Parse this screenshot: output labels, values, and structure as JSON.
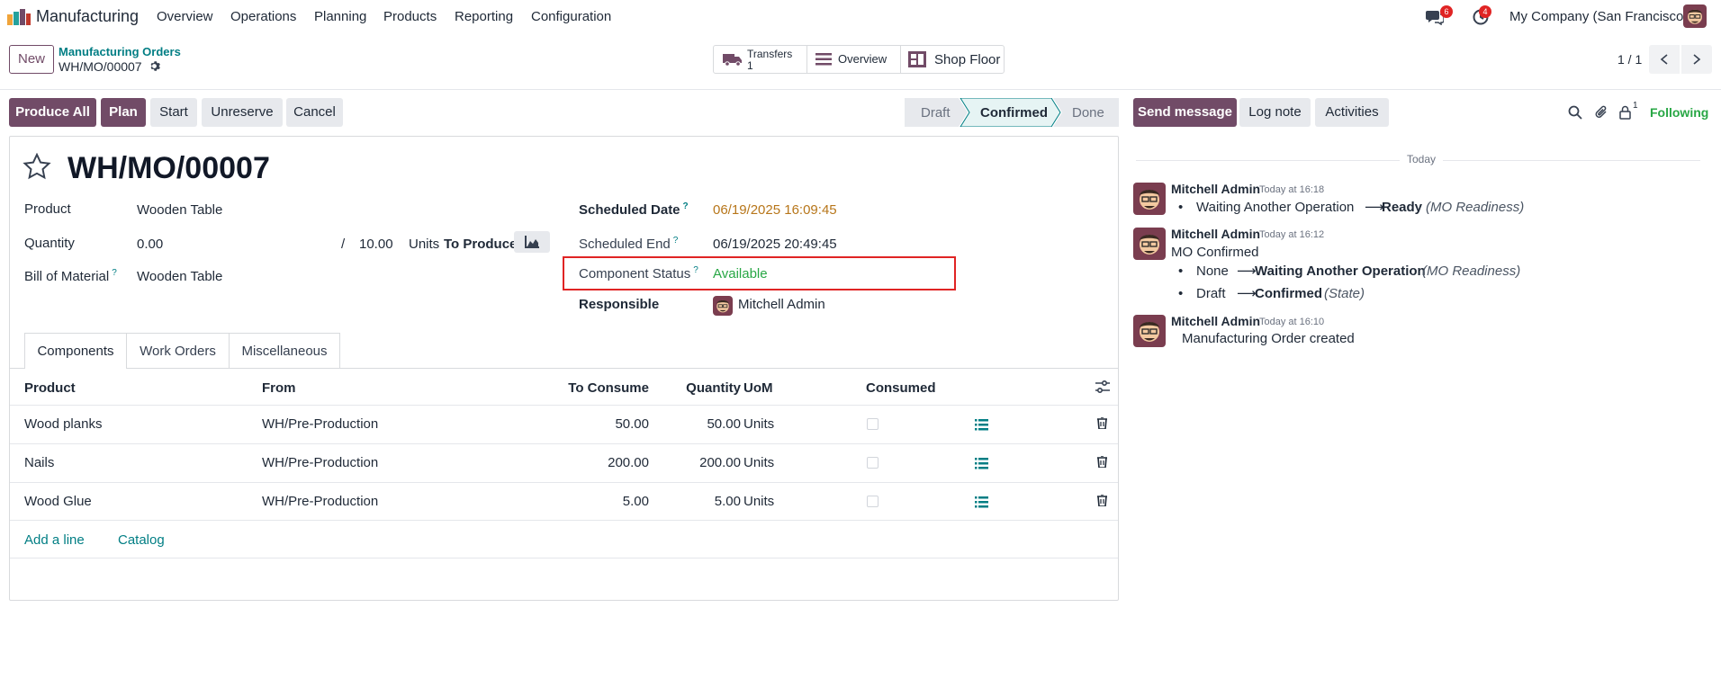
{
  "nav": {
    "app_name": "Manufacturing",
    "menus": [
      "Overview",
      "Operations",
      "Planning",
      "Products",
      "Reporting",
      "Configuration"
    ],
    "messages_badge": "6",
    "activities_badge": "4",
    "company": "My Company (San Francisco)"
  },
  "control": {
    "new_label": "New",
    "breadcrumb_parent": "Manufacturing Orders",
    "record_name": "WH/MO/00007",
    "smart_buttons": {
      "transfers_label": "Transfers",
      "transfers_count": "1",
      "overview_label": "Overview",
      "shop_floor_label": "Shop Floor"
    },
    "pager": "1 / 1"
  },
  "actions": {
    "produce_all": "Produce All",
    "plan": "Plan",
    "start": "Start",
    "unreserve": "Unreserve",
    "cancel": "Cancel"
  },
  "statusbar": {
    "draft": "Draft",
    "confirmed": "Confirmed",
    "done": "Done",
    "active": "Confirmed"
  },
  "form": {
    "title": "WH/MO/00007",
    "product_label": "Product",
    "product_value": "Wooden Table",
    "quantity_label": "Quantity",
    "quantity_value": "0.00",
    "quantity_sep": "/",
    "quantity_target": "10.00",
    "quantity_uom": "Units",
    "to_produce": "To Produce",
    "bom_label": "Bill of Material",
    "bom_value": "Wooden Table",
    "scheduled_date_label": "Scheduled Date",
    "scheduled_date_value": "06/19/2025 16:09:45",
    "scheduled_end_label": "Scheduled End",
    "scheduled_end_value": "06/19/2025 20:49:45",
    "component_status_label": "Component Status",
    "component_status_value": "Available",
    "responsible_label": "Responsible",
    "responsible_value": "Mitchell Admin",
    "help_mark": "?"
  },
  "tabs": [
    "Components",
    "Work Orders",
    "Miscellaneous"
  ],
  "components": {
    "columns": [
      "Product",
      "From",
      "To Consume",
      "Quantity",
      "UoM",
      "Consumed"
    ],
    "rows": [
      {
        "product": "Wood planks",
        "from": "WH/Pre-Production",
        "to_consume": "50.00",
        "quantity": "50.00",
        "uom": "Units"
      },
      {
        "product": "Nails",
        "from": "WH/Pre-Production",
        "to_consume": "200.00",
        "quantity": "200.00",
        "uom": "Units"
      },
      {
        "product": "Wood Glue",
        "from": "WH/Pre-Production",
        "to_consume": "5.00",
        "quantity": "5.00",
        "uom": "Units"
      }
    ],
    "add_line": "Add a line",
    "catalog": "Catalog"
  },
  "chatter": {
    "send_message": "Send message",
    "log_note": "Log note",
    "activities": "Activities",
    "followers_count": "1",
    "following": "Following",
    "today": "Today",
    "messages": [
      {
        "author": "Mitchell Admin",
        "time": "Today at 16:18",
        "changes": [
          {
            "from": "Waiting Another Operation",
            "to": "Ready",
            "field": "(MO Readiness)"
          }
        ]
      },
      {
        "author": "Mitchell Admin",
        "time": "Today at 16:12",
        "body": "MO Confirmed",
        "changes": [
          {
            "from": "None",
            "to": "Waiting Another Operation",
            "field": "(MO Readiness)"
          },
          {
            "from": "Draft",
            "to": "Confirmed",
            "field": "(State)"
          }
        ]
      },
      {
        "author": "Mitchell Admin",
        "time": "Today at 16:10",
        "body": "Manufacturing Order created"
      }
    ]
  },
  "colors": {
    "brand": "#714b67",
    "link": "#017e84",
    "highlight": "#e02424",
    "date_warning": "#b7761a",
    "success": "#28a745"
  }
}
